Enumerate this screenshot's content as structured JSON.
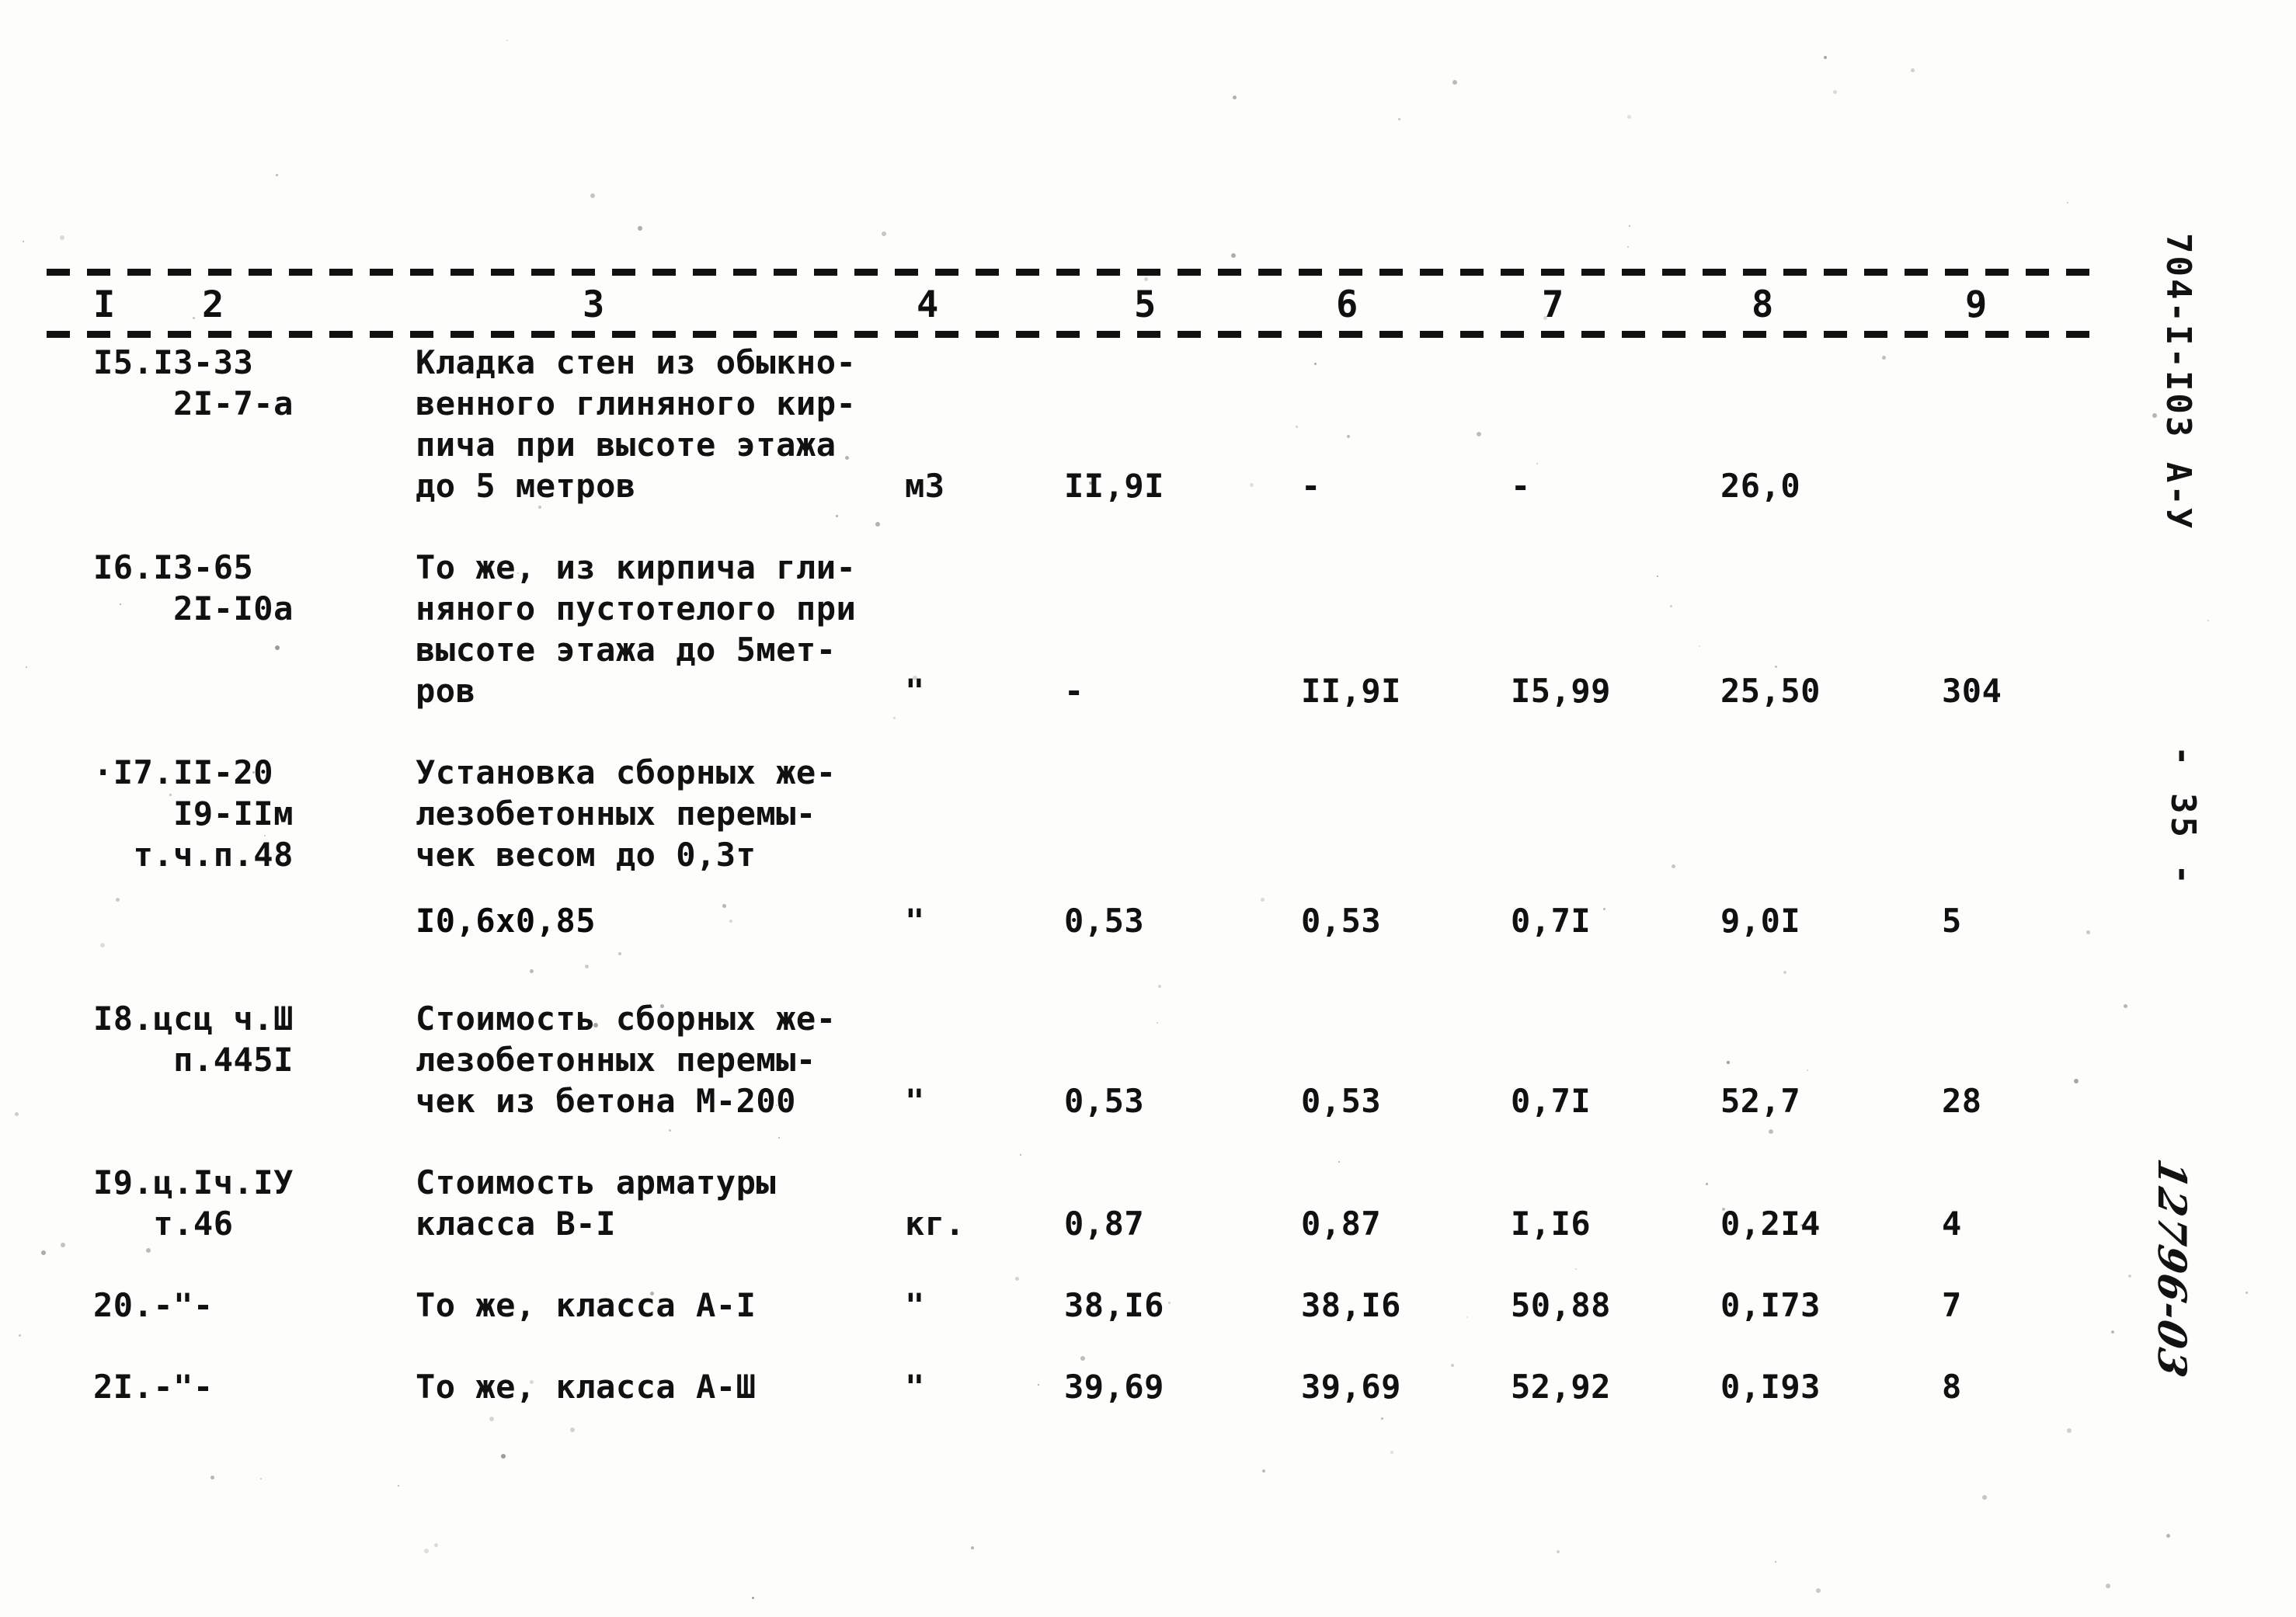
{
  "document": {
    "sheet_number": "704-I-I03 А-У",
    "page_label": "- 35 -",
    "archive_mark": "12796-03"
  },
  "table": {
    "column_headers": [
      "I",
      "2",
      "3",
      "4",
      "5",
      "6",
      "7",
      "8",
      "9"
    ],
    "rows": [
      {
        "code": "I5.I3-33\n    2I-7-а",
        "description": "Кладка стен из обыкно-\nвенного глиняного кир-\nпича при высоте этажа\nдо 5 метров",
        "unit": "м3",
        "c5": "II,9I",
        "c6": "-",
        "c7": "-",
        "c8": "26,0",
        "c9": "",
        "value_line": 3
      },
      {
        "code": "I6.I3-65\n    2I-I0а",
        "description": "То же, из кирпича гли-\nняного пустотелого при\nвысоте этажа до 5мет-\nров",
        "unit": "\"",
        "c5": "-",
        "c6": "II,9I",
        "c7": "I5,99",
        "c8": "25,50",
        "c9": "304",
        "value_line": 3
      },
      {
        "code": "·I7.II-20\n    I9-IIм\n  т.ч.п.48",
        "description": "Установка сборных же-\nлезобетонных перемы-\nчек весом до 0,3т",
        "sub_line": "I0,6х0,85",
        "unit": "\"",
        "c5": "0,53",
        "c6": "0,53",
        "c7": "0,7I",
        "c8": "9,0I",
        "c9": "5",
        "value_line": 3
      },
      {
        "code": "I8.цсц ч.Ш\n    п.445I",
        "description": "Стоимость сборных же-\nлезобетонных перемы-\nчек из бетона М-200",
        "unit": "\"",
        "c5": "0,53",
        "c6": "0,53",
        "c7": "0,7I",
        "c8": "52,7",
        "c9": "28",
        "value_line": 2
      },
      {
        "code": "I9.ц.Iч.IУ\n   т.46",
        "description": "Стоимость арматуры\nкласса В-I",
        "unit": "кг.",
        "c5": "0,87",
        "c6": "0,87",
        "c7": "I,I6",
        "c8": "0,2I4",
        "c9": "4",
        "value_line": 1
      },
      {
        "code": "20.-\"-",
        "description": "То же, класса А-I",
        "unit": "\"",
        "c5": "38,I6",
        "c6": "38,I6",
        "c7": "50,88",
        "c8": "0,I73",
        "c9": "7",
        "value_line": 0
      },
      {
        "code": "2I.-\"-",
        "description": "То же, класса А-Ш",
        "unit": "\"",
        "c5": "39,69",
        "c6": "39,69",
        "c7": "52,92",
        "c8": "0,I93",
        "c9": "8",
        "value_line": 0
      }
    ]
  }
}
